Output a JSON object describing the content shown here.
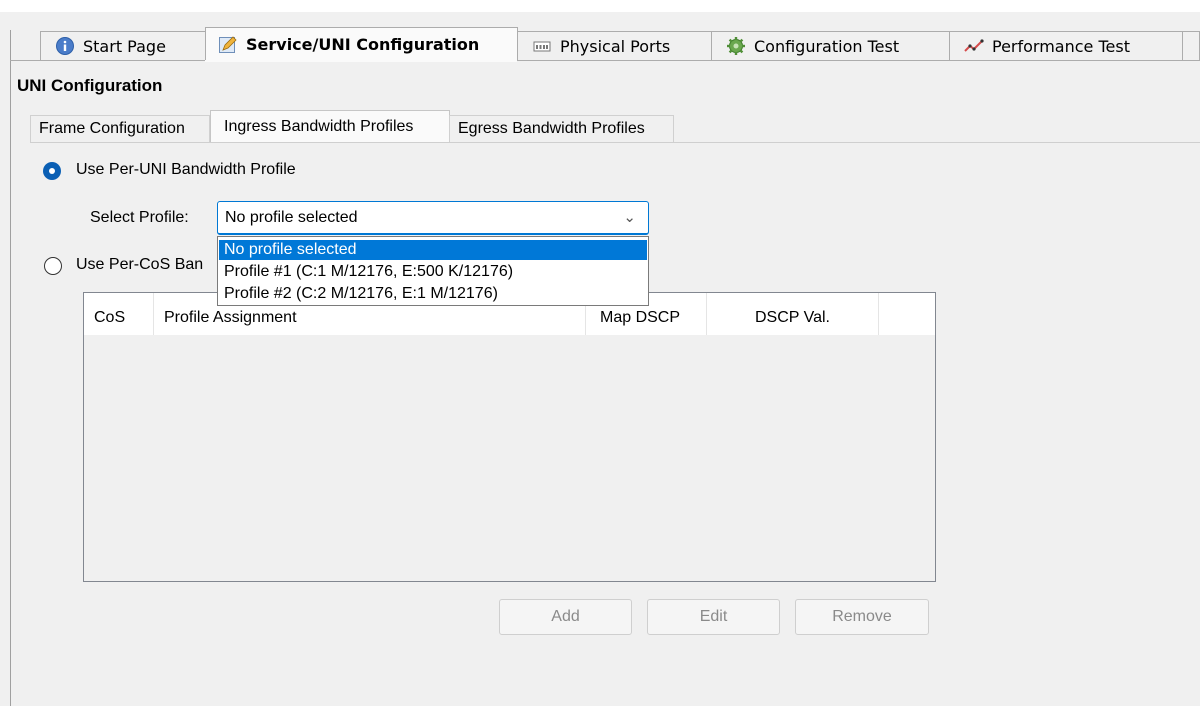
{
  "main_tabs": [
    {
      "label": "Start Page",
      "icon": "info-icon"
    },
    {
      "label": "Service/UNI Configuration",
      "icon": "edit-icon"
    },
    {
      "label": "Physical Ports",
      "icon": "ports-icon"
    },
    {
      "label": "Configuration Test",
      "icon": "gear-icon"
    },
    {
      "label": "Performance Test",
      "icon": "chart-icon"
    }
  ],
  "active_main_tab": "Service/UNI Configuration",
  "section_title": "UNI Configuration",
  "sub_tabs": [
    {
      "label": "Frame Configuration"
    },
    {
      "label": "Ingress Bandwidth Profiles"
    },
    {
      "label": "Egress Bandwidth Profiles"
    }
  ],
  "active_sub_tab": "Ingress Bandwidth Profiles",
  "options": {
    "per_uni_label": "Use Per-UNI Bandwidth Profile",
    "per_uni_selected": true,
    "per_cos_label": "Use Per-CoS Ban",
    "per_cos_selected": false
  },
  "select_profile": {
    "label": "Select Profile:",
    "value": "No profile selected",
    "dropdown_options": [
      "No profile selected",
      "Profile #1 (C:1 M/12176, E:500 K/12176)",
      "Profile #2 (C:2 M/12176, E:1 M/12176)"
    ],
    "highlighted_index": 0
  },
  "table": {
    "columns": [
      "CoS",
      "Profile Assignment",
      "Map DSCP",
      "DSCP Val."
    ],
    "rows": []
  },
  "buttons": {
    "add": "Add",
    "edit": "Edit",
    "remove": "Remove"
  },
  "colors": {
    "accent": "#0078d7",
    "radio_on": "#0a5fb4",
    "disabled_text": "#8a8a8a"
  }
}
